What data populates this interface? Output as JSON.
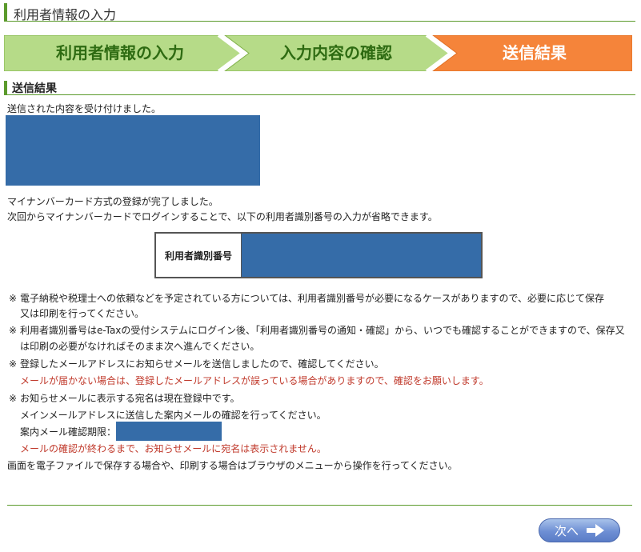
{
  "page": {
    "title": "利用者情報の入力"
  },
  "steps": [
    {
      "label": "利用者情報の入力",
      "state": "done"
    },
    {
      "label": "入力内容の確認",
      "state": "done"
    },
    {
      "label": "送信結果",
      "state": "current"
    }
  ],
  "colors": {
    "step_done": "#b6db88",
    "step_current": "#f5843a",
    "accent_green": "#5b9a2c",
    "redaction": "#356ca8",
    "warning_red": "#c0392b"
  },
  "section": {
    "title": "送信結果"
  },
  "message": {
    "received": "送信された内容を受け付けました。",
    "complete_line1": "マイナンバーカード方式の登録が完了しました。",
    "complete_line2": "次回からマイナンバーカードでログインすることで、以下の利用者識別番号の入力が省略できます。"
  },
  "id_table": {
    "header": "利用者識別番号"
  },
  "notes": {
    "mark": "※",
    "n1_line1": "電子納税や税理士への依頼などを予定されている方については、利用者識別番号が必要になるケースがありますので、必要に応じて保存",
    "n1_line2": "又は印刷を行ってください。",
    "n2_line1": "利用者識別番号はe-Taxの受付システムにログイン後、「利用者識別番号の通知・確認」から、いつでも確認することができますので、保存又",
    "n2_line2": "は印刷の必要がなければそのまま次へ進んでください。",
    "n3_line1": "登録したメールアドレスにお知らせメールを送信しましたので、確認してください。",
    "n3_red": "メールが届かない場合は、登録したメールアドレスが誤っている場合がありますので、確認をお願いします。",
    "n4_line1": "お知らせメールに表示する宛名は現在登録中です。",
    "n4_line2": "メインメールアドレスに送信した案内メールの確認を行ってください。",
    "n4_deadline_label": "案内メール確認期限：",
    "n4_red": "メールの確認が終わるまで、お知らせメールに宛名は表示されません。",
    "footer": "画面を電子ファイルで保存する場合や、印刷する場合はブラウザのメニューから操作を行ってください。"
  },
  "buttons": {
    "next_label": "次へ"
  }
}
